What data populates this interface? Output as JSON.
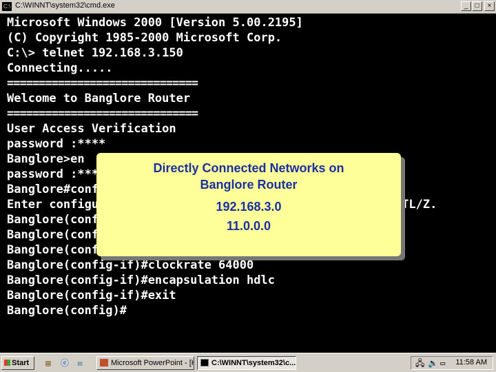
{
  "window": {
    "title": "C:\\WINNT\\system32\\cmd.exe",
    "icon_label": "C:\\",
    "buttons": {
      "minimize": "_",
      "maximize": "□",
      "close": "×"
    }
  },
  "console_lines": [
    "Microsoft Windows 2000 [Version 5.00.2195]",
    "(C) Copyright 1985-2000 Microsoft Corp.",
    "C:\\> telnet 192.168.3.150",
    "Connecting.....",
    "==============================",
    "Welcome to Banglore Router",
    "==============================",
    "User Access Verification",
    "password :****",
    "Banglore>en",
    "password :****",
    "Banglore#config t",
    "Enter configuration commands, one per line.  End with CNTL/Z.",
    "Banglore(config)#int s0",
    "Banglore(config-if)#ip add 11.0.0.1 255.0.0.0",
    "Banglore(config-if)#no shut",
    "Banglore(config-if)#clockrate 64000",
    "Banglore(config-if)#encapsulation hdlc",
    "Banglore(config-if)#exit",
    "Banglore(config)#"
  ],
  "callout": {
    "title_line1": "Directly Connected Networks on",
    "title_line2": "Banglore Router",
    "networks": [
      "192.168.3.0",
      "11.0.0.0"
    ]
  },
  "taskbar": {
    "start_label": "Start",
    "tasks": [
      {
        "label": "Microsoft PowerPoint - [H...",
        "active": false
      },
      {
        "label": "C:\\WINNT\\system32\\c...",
        "active": true
      }
    ],
    "clock": "11:58 AM"
  }
}
